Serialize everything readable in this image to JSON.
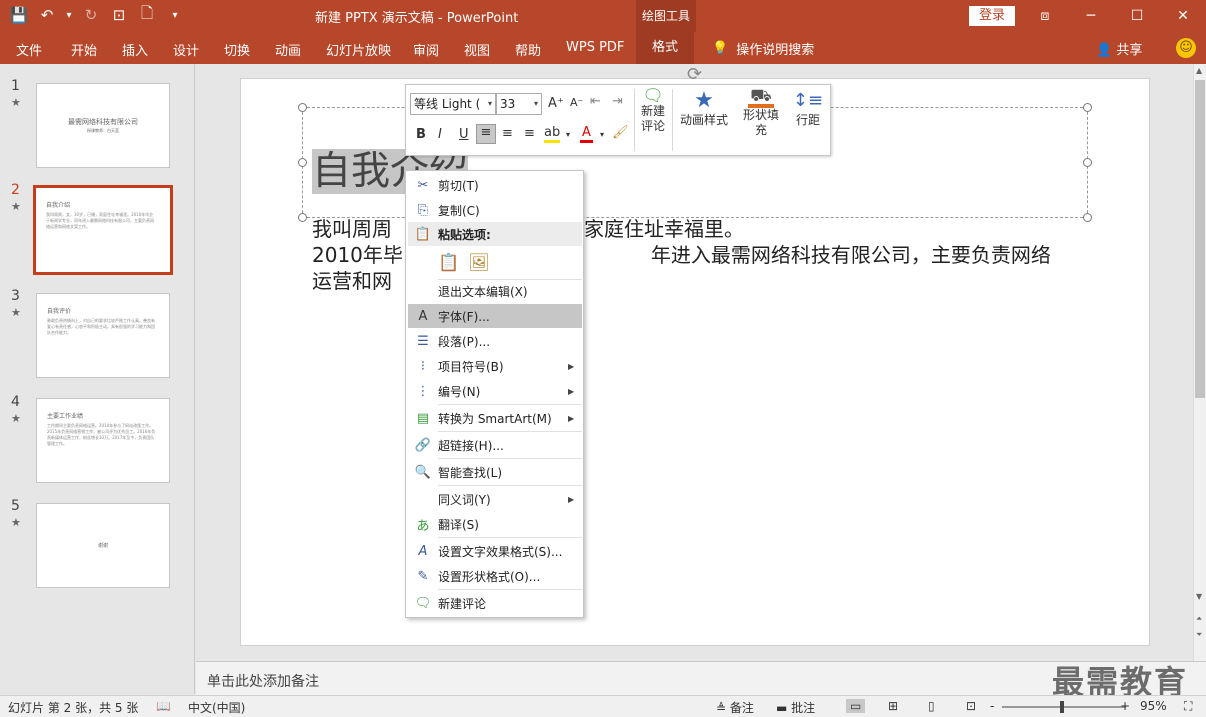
{
  "window": {
    "title": "新建 PPTX 演示文稿 - PowerPoint",
    "context_group": "绘图工具",
    "login_label": "登录",
    "minimize": "─",
    "maximize": "☐",
    "close": "✕",
    "ribbon_display": "⧈"
  },
  "qat": {
    "save_icon": "💾",
    "undo_icon": "↶",
    "undo_menu": "▾",
    "redo_icon": "↻",
    "slideshow_icon": "⊡",
    "new_icon": "🗋",
    "customize": "▾"
  },
  "ribbon": {
    "tabs": [
      "文件",
      "开始",
      "插入",
      "设计",
      "切换",
      "动画",
      "幻灯片放映",
      "审阅",
      "视图",
      "帮助",
      "WPS PDF",
      "格式"
    ],
    "active_tab": "格式",
    "tell_me": "操作说明搜索",
    "share": "共享",
    "smiley": "☺"
  },
  "thumbnails": [
    {
      "num": "1",
      "title": "最需网络科技有限公司",
      "body": "授课教师：白天蓝"
    },
    {
      "num": "2",
      "title": "自我介绍",
      "body": "我叫周周，女，30岁，已婚，家庭住址幸福里。2010年毕业于新闻学专业，同年进入最需网络科技有限公司，主要负责网络运营和网络文案工作。"
    },
    {
      "num": "3",
      "title": "自我评价",
      "body": "勇敢负责热情向上，对自己的要求比较严格工作认真。善良有爱心有责任感，心态平和积极主动。具有很强的学习能力和团队合作能力。"
    },
    {
      "num": "4",
      "title": "主要工作业绩",
      "body": "工作期间主要负责网络运营。2014年参与了网站改版工作。2015年负责网络营销工作，被公司评为优秀员工。2016年负责新媒体运营工作，粉丝增长10万。2017年至今，负责团队管理工作。"
    },
    {
      "num": "5",
      "title": "谢谢",
      "body": ""
    }
  ],
  "slide": {
    "title": "自我介绍",
    "body_lines": [
      "我叫周周，女，30岁，已婚，家庭住址幸福里。",
      "2010年毕业于新闻学专业，同年进入最需网络科技有限公司，主要负责网络",
      "运营和网络文案工作。"
    ],
    "visible_body_lines": [
      "我叫周周",
      "，家庭住址幸福里。",
      "2010年毕",
      "年进入最需网络科技有限公司，主要负责网络",
      "运营和网"
    ]
  },
  "mini_toolbar": {
    "font": "等线 Light (",
    "size": "33",
    "grow_font": "A⁺",
    "shrink_font": "A⁻",
    "bold": "B",
    "italic": "I",
    "underline": "U",
    "new_comment": [
      "新建",
      "评论"
    ],
    "animation_styles": "动画样式",
    "shape_fill": [
      "形状填",
      "充"
    ],
    "line_spacing": "行距"
  },
  "context_menu": {
    "items": [
      {
        "icon": "✂",
        "label": "剪切(T)",
        "submenu": false
      },
      {
        "icon": "⎘",
        "label": "复制(C)",
        "submenu": false
      },
      {
        "icon": "📋",
        "label": "粘贴选项:",
        "submenu": false,
        "header": true
      },
      {
        "icon": "",
        "label": "退出文本编辑(X)",
        "submenu": false
      },
      {
        "icon": "A",
        "label": "字体(F)...",
        "submenu": false,
        "hover": true
      },
      {
        "icon": "☰",
        "label": "段落(P)...",
        "submenu": false
      },
      {
        "icon": "⁝",
        "label": "项目符号(B)",
        "submenu": true
      },
      {
        "icon": "⋮",
        "label": "编号(N)",
        "submenu": true
      },
      {
        "icon": "▤",
        "label": "转换为 SmartArt(M)",
        "submenu": true
      },
      {
        "icon": "🔗",
        "label": "超链接(H)...",
        "submenu": false
      },
      {
        "icon": "🔍",
        "label": "智能查找(L)",
        "submenu": false
      },
      {
        "icon": "",
        "label": "同义词(Y)",
        "submenu": true
      },
      {
        "icon": "あ",
        "label": "翻译(S)",
        "submenu": false
      },
      {
        "icon": "A",
        "label": "设置文字效果格式(S)...",
        "submenu": false
      },
      {
        "icon": "✎",
        "label": "设置形状格式(O)...",
        "submenu": false
      },
      {
        "icon": "🗨",
        "label": "新建评论",
        "submenu": false
      }
    ]
  },
  "notes": {
    "placeholder": "单击此处添加备注"
  },
  "watermark": "最需教育",
  "status": {
    "slide_info": "幻灯片 第 2 张，共 5 张",
    "language": "中文(中国)",
    "notes": "备注",
    "comments": "批注",
    "zoom": "95%",
    "zoom_minus": "-",
    "zoom_plus": "+"
  }
}
